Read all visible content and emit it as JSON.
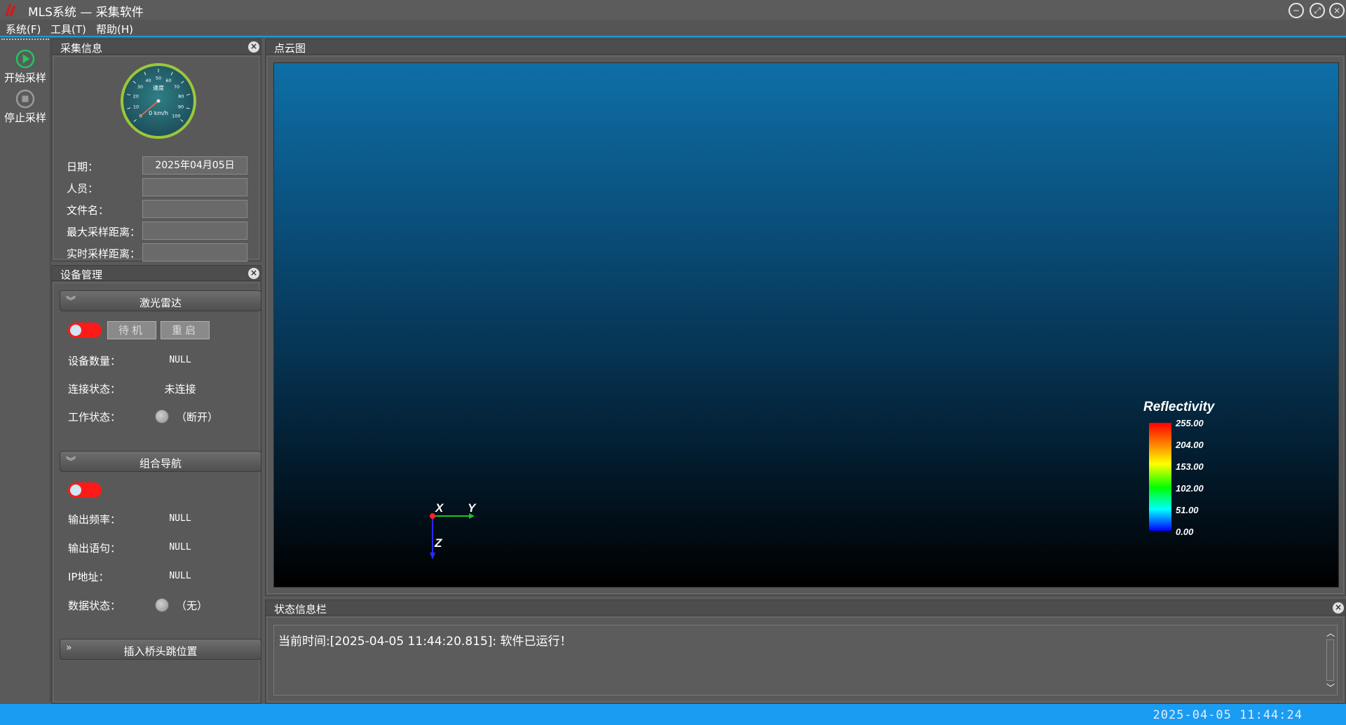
{
  "window": {
    "title": "MLS系统 — 采集软件",
    "controls": {
      "minimize": "−",
      "restore": "⤢",
      "close": "×"
    }
  },
  "menu": [
    {
      "label": "系统(F)"
    },
    {
      "label": "工具(T)"
    },
    {
      "label": "帮助(H)"
    }
  ],
  "toolbar": {
    "start_label": "开始采样",
    "stop_label": "停止采样"
  },
  "collect_panel": {
    "title": "采集信息",
    "gauge": {
      "title": "速度",
      "readout": "0 km/h",
      "ticks": [
        "0",
        "10",
        "20",
        "30",
        "40",
        "50",
        "60",
        "70",
        "80",
        "90",
        "100"
      ],
      "value": 0
    },
    "fields": [
      {
        "label": "日期：",
        "value": "2025年04月05日"
      },
      {
        "label": "人员：",
        "value": ""
      },
      {
        "label": "文件名：",
        "value": ""
      },
      {
        "label": "最大采样距离：",
        "value": ""
      },
      {
        "label": "实时采样距离：",
        "value": ""
      }
    ]
  },
  "device_panel": {
    "title": "设备管理",
    "lidar": {
      "section_label": "激光雷达",
      "standby_btn": "待机",
      "restart_btn": "重启",
      "count_label": "设备数量：",
      "count_value": "NULL",
      "conn_label": "连接状态：",
      "conn_value": "未连接",
      "work_label": "工作状态：",
      "work_value": "（断开）"
    },
    "nav": {
      "section_label": "组合导航",
      "freq_label": "输出频率：",
      "freq_value": "NULL",
      "sentence_label": "输出语句：",
      "sentence_value": "NULL",
      "ip_label": "IP地址：",
      "ip_value": "NULL",
      "data_label": "数据状态：",
      "data_value": "（无）"
    },
    "bridge": {
      "section_label": "插入桥头跳位置"
    }
  },
  "cloud_panel": {
    "title": "点云图",
    "axes": {
      "x": "X",
      "y": "Y",
      "z": "Z"
    },
    "colorbar": {
      "title": "Reflectivity",
      "ticks": [
        "255.00",
        "204.00",
        "153.00",
        "102.00",
        "51.00",
        "0.00"
      ]
    }
  },
  "status_panel": {
    "title": "状态信息栏",
    "message": "当前时间:[2025-04-05 11:44:20.815]: 软件已运行！"
  },
  "status_bar": {
    "clock": "2025-04-05  11:44:24"
  },
  "colors": {
    "accent": "#1a9cf2",
    "toggle_off": "#ff1a1a",
    "play_green": "#22c55e"
  }
}
